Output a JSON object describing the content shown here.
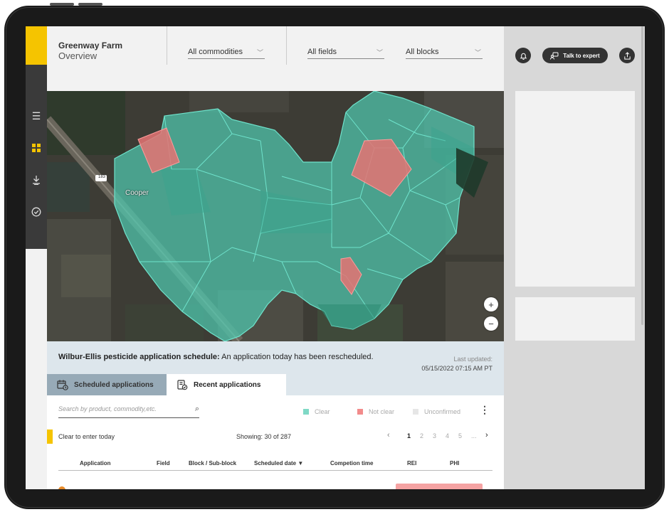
{
  "header": {
    "farm_name": "Greenway Farm",
    "subtitle": "Overview",
    "commodities": "All commodities",
    "fields": "All fields",
    "blocks": "All blocks"
  },
  "right_panel": {
    "talk_label": "Talk to expert"
  },
  "map": {
    "place_label": "Cooper",
    "road_label": "183",
    "zoom_in": "+",
    "zoom_out": "−"
  },
  "banner": {
    "title": "Wilbur-Ellis pesticide application schedule:",
    "message": "An application today has been rescheduled.",
    "updated_label": "Last updated:",
    "updated_value": "05/15/2022  07:15 AM PT"
  },
  "tabs": {
    "scheduled": "Scheduled applications",
    "recent": "Recent applications"
  },
  "table": {
    "search_placeholder": "Search by product, commodity,etc.",
    "legend": [
      {
        "label": "Clear",
        "color": "#7fd9c6"
      },
      {
        "label": "Not clear",
        "color": "#f28b8b"
      },
      {
        "label": "Unconfirmed",
        "color": "#e6e6e6"
      }
    ],
    "clear_text": "Clear to enter today",
    "showing": "Showing: 30 of 287",
    "pager": {
      "prev": "‹",
      "pages": [
        "1",
        "2",
        "3",
        "4",
        "5",
        "..."
      ],
      "next": "›",
      "current": "1"
    },
    "columns": [
      "Application",
      "Field",
      "Block / Sub-block",
      "Scheduled date ▼",
      "Competion time",
      "REI",
      "PHI"
    ]
  },
  "colors": {
    "brand_yellow": "#f5c400",
    "field_clear": "#4fc9b0",
    "field_not_clear": "#e57373"
  }
}
